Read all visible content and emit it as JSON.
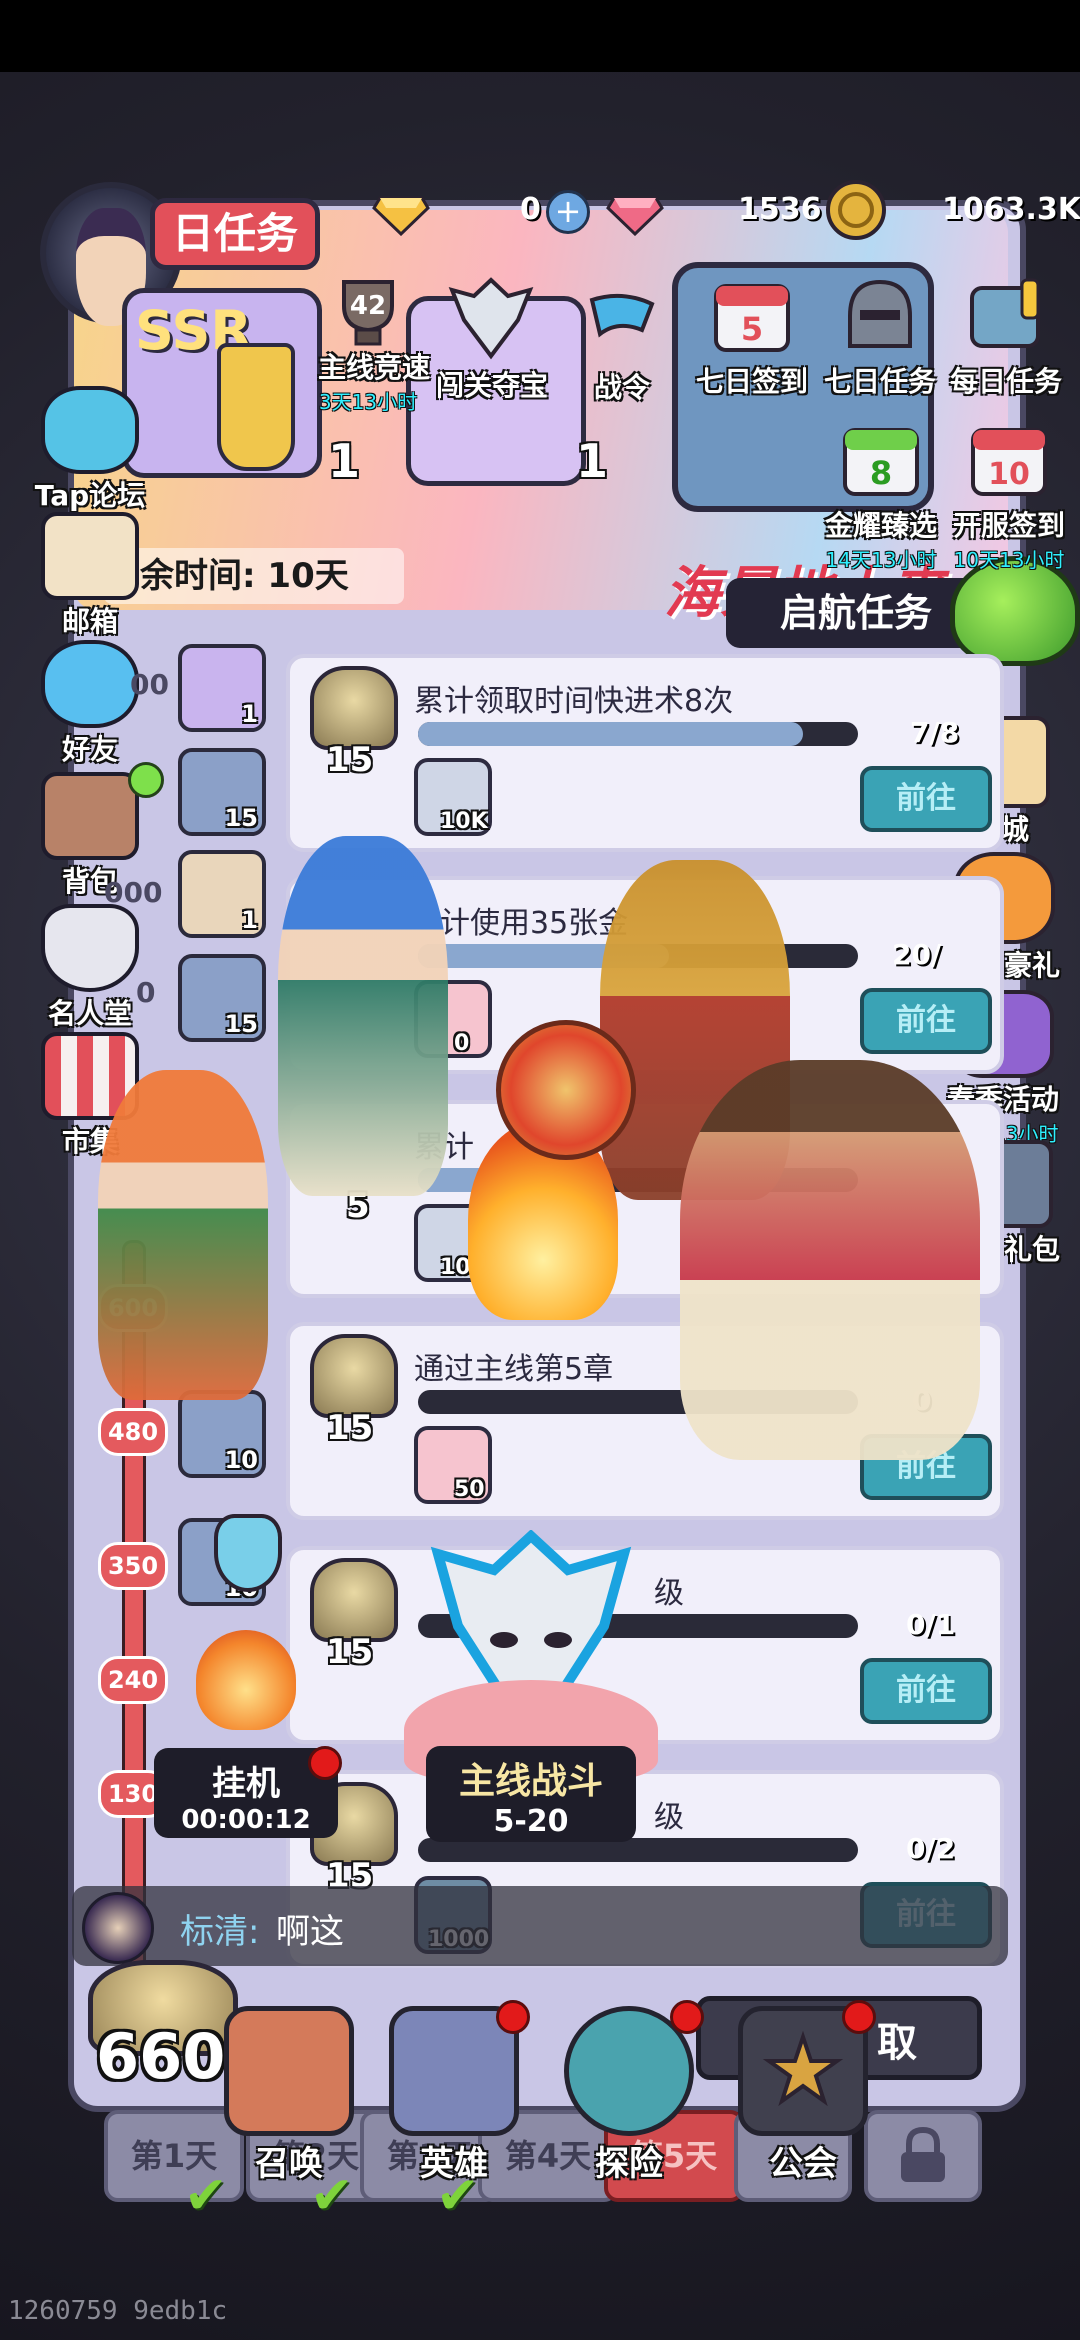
{
  "header": {
    "title": "日任务",
    "resources": [
      {
        "icon": "gold-gem-icon",
        "value": "0"
      },
      {
        "icon": "pink-gem-icon",
        "value": "1536"
      },
      {
        "icon": "coin-icon",
        "value": "1063.3K"
      }
    ]
  },
  "banner": {
    "item_counts": [
      "1",
      "1"
    ],
    "remaining_time": "余时间: 10天",
    "slogan": "海景地上来",
    "launch_button": "启航任务"
  },
  "top_icons": [
    {
      "label": "主线竞速",
      "sub": "3天13小时",
      "badge": "42"
    },
    {
      "label": "闯关夺宝",
      "sub": ""
    },
    {
      "label": "战令",
      "sub": ""
    },
    {
      "label": "七日签到",
      "sub": "",
      "badge": "5"
    },
    {
      "label": "七日任务",
      "sub": ""
    },
    {
      "label": "每日任务",
      "sub": ""
    },
    {
      "label": "金耀臻选",
      "sub": "14天13小时",
      "badge": "8"
    },
    {
      "label": "开服签到",
      "sub": "10天13小时",
      "badge": "10"
    }
  ],
  "left_menu": [
    {
      "label": "Tap论坛"
    },
    {
      "label": "邮箱"
    },
    {
      "label": "好友"
    },
    {
      "label": "背包"
    },
    {
      "label": "名人堂"
    },
    {
      "label": "市集"
    }
  ],
  "right_menu": [
    {
      "label": "商城",
      "sub": ""
    },
    {
      "label": "首充豪礼",
      "sub": ""
    },
    {
      "label": "春季活动",
      "sub": "11天13小时"
    },
    {
      "label": "新手礼包",
      "sub": ""
    }
  ],
  "milestone_tiles": [
    {
      "count": "1"
    },
    {
      "count": "15"
    },
    {
      "count": "1"
    },
    {
      "count": "15"
    },
    {
      "count": "10"
    },
    {
      "count": "10"
    }
  ],
  "milestone_partials": [
    "00",
    "000",
    "0"
  ],
  "milestones": [
    "600",
    "480",
    "350",
    "240",
    "130"
  ],
  "tasks": [
    {
      "name": "累计领取时间快进术8次",
      "points": "15",
      "reward": "10K",
      "progress": "7/8",
      "progress_ratio": 0.875,
      "button": "前往"
    },
    {
      "name": "计使用35张金",
      "points": "",
      "reward": "0",
      "progress": "20/",
      "progress_ratio": 0.57,
      "button": "前往"
    },
    {
      "name": "累计",
      "points": "5",
      "reward": "10K",
      "progress": "",
      "progress_ratio": 0.2,
      "button": ""
    },
    {
      "name": "通过主线第5章",
      "points": "15",
      "reward": "50",
      "progress": "0",
      "progress_ratio": 0.0,
      "button": "前往"
    },
    {
      "name": "级",
      "points": "15",
      "reward": "",
      "progress": "0/1",
      "progress_ratio": 0.0,
      "button": "前往"
    },
    {
      "name": "级",
      "points": "15",
      "reward": "1000",
      "progress": "0/2",
      "progress_ratio": 0.0,
      "button": "前往"
    }
  ],
  "idle": {
    "label": "挂机",
    "timer": "00:00:12"
  },
  "main_battle": {
    "label": "主线战斗",
    "stage": "5-20"
  },
  "chat": {
    "user": "标清:",
    "message": "啊这"
  },
  "score": "660",
  "claim_button": "取",
  "bottom_nav": [
    {
      "label": "召唤",
      "dot": false
    },
    {
      "label": "英雄",
      "dot": true
    },
    {
      "label": "探险",
      "dot": true
    },
    {
      "label": "公会",
      "dot": true
    }
  ],
  "day_tabs": [
    "第1天",
    "第2天",
    "第3天",
    "第4天",
    "第5天"
  ],
  "footer": "1260759 9edb1c"
}
